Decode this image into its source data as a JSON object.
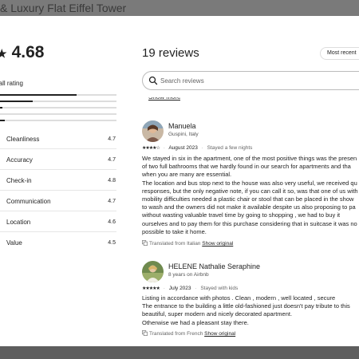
{
  "background": {
    "listing_title": "& Luxury Flat Eiffel Tower"
  },
  "summary": {
    "rating": "4.68",
    "overall_label": "rall rating",
    "distribution": [
      0.66,
      0.28,
      0.02,
      0.0,
      0.04
    ],
    "categories": [
      {
        "label": "Cleanliness",
        "value": "4.7"
      },
      {
        "label": "Accuracy",
        "value": "4.7"
      },
      {
        "label": "Check-in",
        "value": "4.8"
      },
      {
        "label": "Communication",
        "value": "4.7"
      },
      {
        "label": "Location",
        "value": "4.6"
      },
      {
        "label": "Value",
        "value": "4.5"
      }
    ]
  },
  "reviews_header": {
    "title": "19 reviews",
    "sort_label": "Most recent",
    "search_placeholder": "Search reviews",
    "show_more": "Show more"
  },
  "reviews": [
    {
      "name": "Manuela",
      "subtitle": "Guspini, Italy",
      "stars": "★★★★☆",
      "date": "August 2023",
      "stay": "Stayed a few nights",
      "lines": [
        "We stayed in six in the apartment, one of the most positive things was the presen",
        "of two full bathrooms that we hardly found in our search for apartments and tha",
        "when you are many are essential.",
        "The location and bus stop next to the house was also very useful, we received qu",
        "responses, but the only negative note, if you can call it so, was that one of us with",
        "mobility difficulties needed a plastic chair or stool that can be placed in the show",
        "to wash and the owners did not make it available despite us also proposing to pa",
        "without wasting valuable travel time by going to shopping , we had to buy it",
        "ourselves and to pay them for this purchase considering that in suitcase it was no",
        "possible to take it home."
      ],
      "translated": "Translated from Italian",
      "show_original": "Show original"
    },
    {
      "name": "HELENE Nathalie Seraphine",
      "subtitle": "8 years on Airbnb",
      "stars": "★★★★★",
      "date": "July 2023",
      "stay": "Stayed with kids",
      "lines": [
        "Listing in accordance with photos . Clean , modern , well located , secure",
        "The entrance to the building a little old-fashioned just doesn't pay tribute to this",
        "beautiful, super modern and nicely decorated apartment.",
        "Otherwise we had a pleasant stay there."
      ],
      "translated": "Translated from French",
      "show_original": "Show original"
    }
  ]
}
